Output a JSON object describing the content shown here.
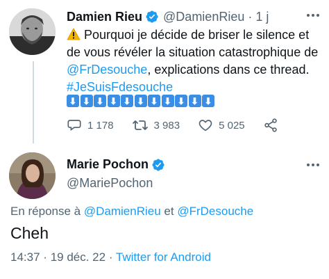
{
  "parent_tweet": {
    "author_name": "Damien Rieu",
    "author_handle": "@DamienRieu",
    "separator": "·",
    "time": "1 j",
    "body_line1": "Pourquoi je décide de briser le silence et",
    "body_line2": "de vous révéler la situation catastrophique de",
    "mention": "@FrDesouche",
    "body_line3_rest": ", explications dans ce thread.",
    "hashtag": "#JeSuisFdesouche",
    "arrow_emoji_count": 11,
    "arrow_glyph": "⬇",
    "replies": "1 178",
    "retweets": "3 983",
    "likes": "5 025"
  },
  "reply_tweet": {
    "author_name": "Marie Pochon",
    "author_handle": "@MariePochon",
    "replying_prefix": "En réponse à",
    "replying_to_1": "@DamienRieu",
    "replying_and": "et",
    "replying_to_2": "@FrDesouche",
    "text": "Cheh",
    "time": "14:37",
    "dot": "·",
    "date": "19 déc. 22",
    "client": "Twitter for Android"
  },
  "colors": {
    "accent": "#1d9bf0",
    "text_primary": "#0f1419",
    "text_secondary": "#536471",
    "arrow_box": "#3a8ee6"
  },
  "icons": [
    "verified-badge-icon",
    "warning-icon",
    "more-options-icon",
    "reply-icon",
    "retweet-icon",
    "like-icon",
    "share-icon"
  ]
}
